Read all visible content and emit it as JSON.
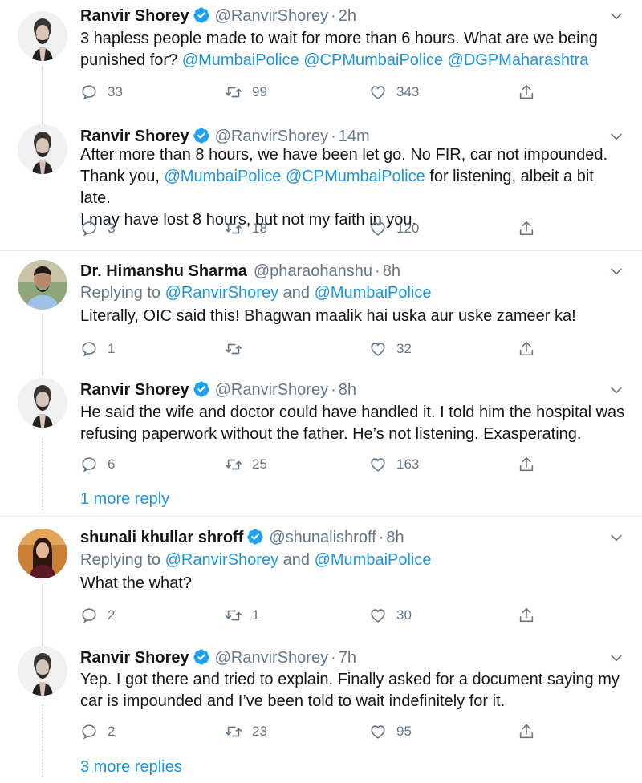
{
  "tweets": [
    {
      "name": "Ranvir Shorey",
      "handle": "@RanvirShorey",
      "time": "2h",
      "verified": true,
      "text_parts": [
        "3 hapless people made to wait for more than 6 hours. What are we being punished for? ",
        "@MumbaiPolice",
        " ",
        "@CPMumbaiPolice",
        " ",
        "@DGPMaharashtra"
      ],
      "replies": "33",
      "retweets": "99",
      "likes": "343"
    },
    {
      "name": "Ranvir Shorey",
      "handle": "@RanvirShorey",
      "time": "14m",
      "verified": true,
      "text_line1": "After more than 8 hours, we have been let go. No FIR, car not impounded.",
      "text_line2_a": "Thank you, ",
      "text_line2_m1": "@MumbaiPolice",
      "text_line2_m2": "@CPMumbaiPolice",
      "text_line2_b": " for listening, albeit a bit late.",
      "text_line3": "I may have lost 8 hours, but not my faith in you.",
      "replies": "3",
      "retweets": "18",
      "likes": "120"
    },
    {
      "name": "Dr. Himanshu Sharma",
      "handle": "@pharaohanshu",
      "time": "8h",
      "verified": false,
      "replying_prefix": "Replying to ",
      "replying_m1": "@RanvirShorey",
      "replying_and": " and ",
      "replying_m2": "@MumbaiPolice",
      "text": "Literally, OIC said this! Bhagwan maalik hai uska aur uske zameer ka!",
      "replies": "1",
      "retweets": "",
      "likes": "32"
    },
    {
      "name": "Ranvir Shorey",
      "handle": "@RanvirShorey",
      "time": "8h",
      "verified": true,
      "text": "He said the wife and doctor could have handled it. I told him the hospital was refusing paperwork without the father. He’s not listening. Exasperating.",
      "replies": "6",
      "retweets": "25",
      "likes": "163",
      "more": "1 more reply"
    },
    {
      "name": "shunali khullar shroff",
      "handle": "@shunalishroff",
      "time": "8h",
      "verified": true,
      "replying_prefix": "Replying to ",
      "replying_m1": "@RanvirShorey",
      "replying_and": " and ",
      "replying_m2": "@MumbaiPolice",
      "text": "What the what?",
      "replies": "2",
      "retweets": "1",
      "likes": "30"
    },
    {
      "name": "Ranvir Shorey",
      "handle": "@RanvirShorey",
      "time": "7h",
      "verified": true,
      "text": "Yep. I got there and tried to explain. Finally asked for a document saying my car is impounded and I’ve been told to wait indefinitely for it.",
      "replies": "2",
      "retweets": "23",
      "likes": "95",
      "more": "3 more replies"
    }
  ],
  "dot": "·",
  "colors": {
    "link": "#1b95e0",
    "muted": "#657786",
    "verified": "#1da1f2"
  }
}
